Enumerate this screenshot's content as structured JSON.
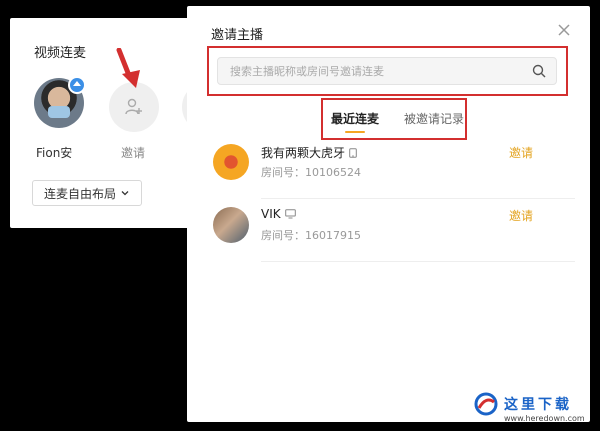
{
  "left_panel": {
    "title": "视频连麦",
    "user_name": "Fion安",
    "invite_label": "邀请",
    "layout_dropdown": "连麦自由布局"
  },
  "modal": {
    "title": "邀请主播",
    "search_placeholder": "搜索主播昵称或房间号邀请连麦",
    "tabs": [
      {
        "label": "最近连麦",
        "active": true
      },
      {
        "label": "被邀请记录",
        "active": false
      }
    ],
    "rows": [
      {
        "name": "我有两颗大虎牙",
        "device_icon": "phone-icon",
        "room": "房间号：10106524",
        "action": "邀请"
      },
      {
        "name": "VIK",
        "device_icon": "monitor-icon",
        "room": "房间号：16017915",
        "action": "邀请"
      }
    ]
  },
  "watermark": {
    "text": "这里下载",
    "url": "www.heredown.com"
  },
  "colors": {
    "accent": "#e3a31f",
    "highlight": "#d32f2f",
    "tab_underline": "#f5a623"
  }
}
